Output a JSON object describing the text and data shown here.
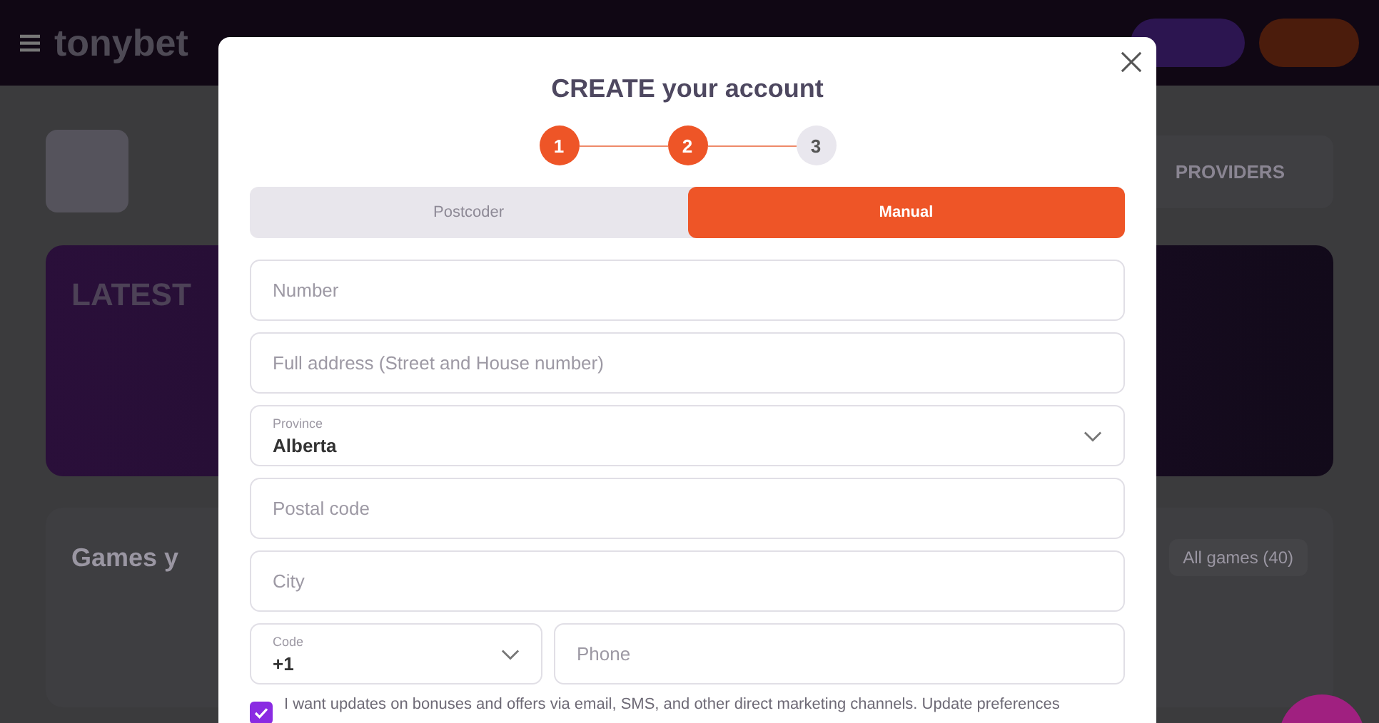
{
  "header": {
    "logo": "tonybet"
  },
  "background": {
    "providers": "PROVIDERS",
    "banner_title": "LATEST",
    "section_title": "Games y",
    "all_games": "All games (40)"
  },
  "modal": {
    "title": "CREATE your account",
    "steps": [
      {
        "label": "1",
        "done": true
      },
      {
        "label": "2",
        "done": true
      },
      {
        "label": "3",
        "done": false
      }
    ],
    "tabs": [
      {
        "label": "Postcoder",
        "selected": false
      },
      {
        "label": "Manual",
        "selected": true
      }
    ],
    "fields": [
      {
        "kind": "text",
        "placeholder": "Number"
      },
      {
        "kind": "text",
        "placeholder": "Full address (Street and House number)"
      },
      {
        "kind": "select",
        "label": "Province",
        "value": "Alberta"
      },
      {
        "kind": "text",
        "placeholder": "Postal code"
      },
      {
        "kind": "text",
        "placeholder": "City"
      }
    ],
    "phone": {
      "code_label": "Code",
      "code_value": "+1",
      "placeholder": "Phone"
    },
    "consent": {
      "checked": true,
      "text": "I want updates on bonuses and offers via email, SMS, and other direct marketing channels. Update preferences"
    }
  }
}
